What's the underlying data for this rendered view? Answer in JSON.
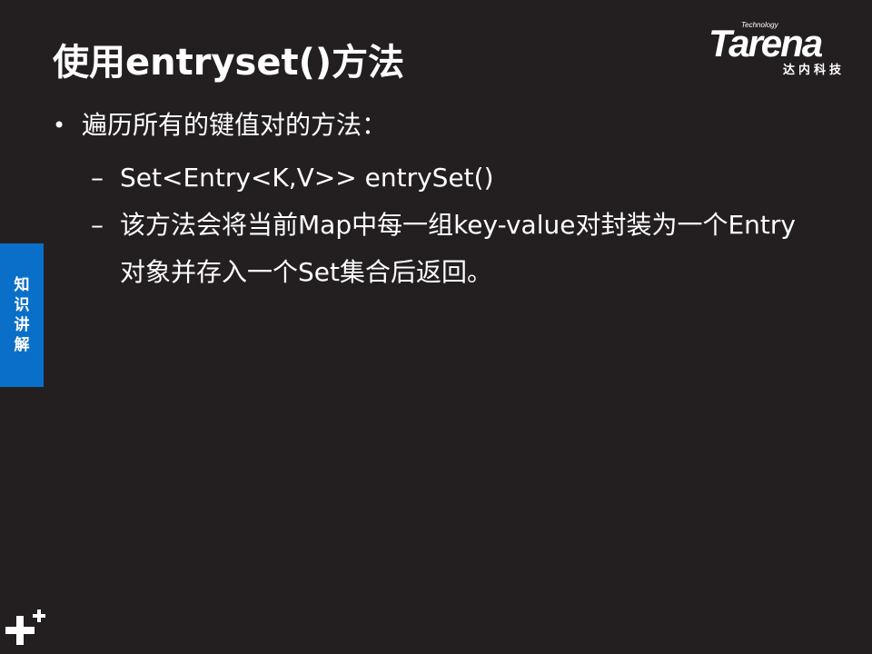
{
  "slide": {
    "title": "使用entryset()方法",
    "logo": {
      "small_text": "Technology",
      "word": "Tarena",
      "cn": "达内科技"
    },
    "bullets": [
      {
        "mark": "•",
        "text": "遍历所有的键值对的方法："
      }
    ],
    "sub_items": [
      {
        "mark": "–",
        "text": "Set<Entry<K,V>> entrySet()"
      },
      {
        "mark": "–",
        "text": "该方法会将当前Map中每一组key-value对封装为一个Entry对象并存入一个Set集合后返回。"
      }
    ],
    "side_tab": [
      "知",
      "识",
      "讲",
      "解"
    ],
    "colors": {
      "background": "#231f20",
      "side_tab": "#0a6fc8",
      "text": "#ffffff"
    },
    "icons": {
      "bottom_left": "plus-logo-icon"
    }
  }
}
